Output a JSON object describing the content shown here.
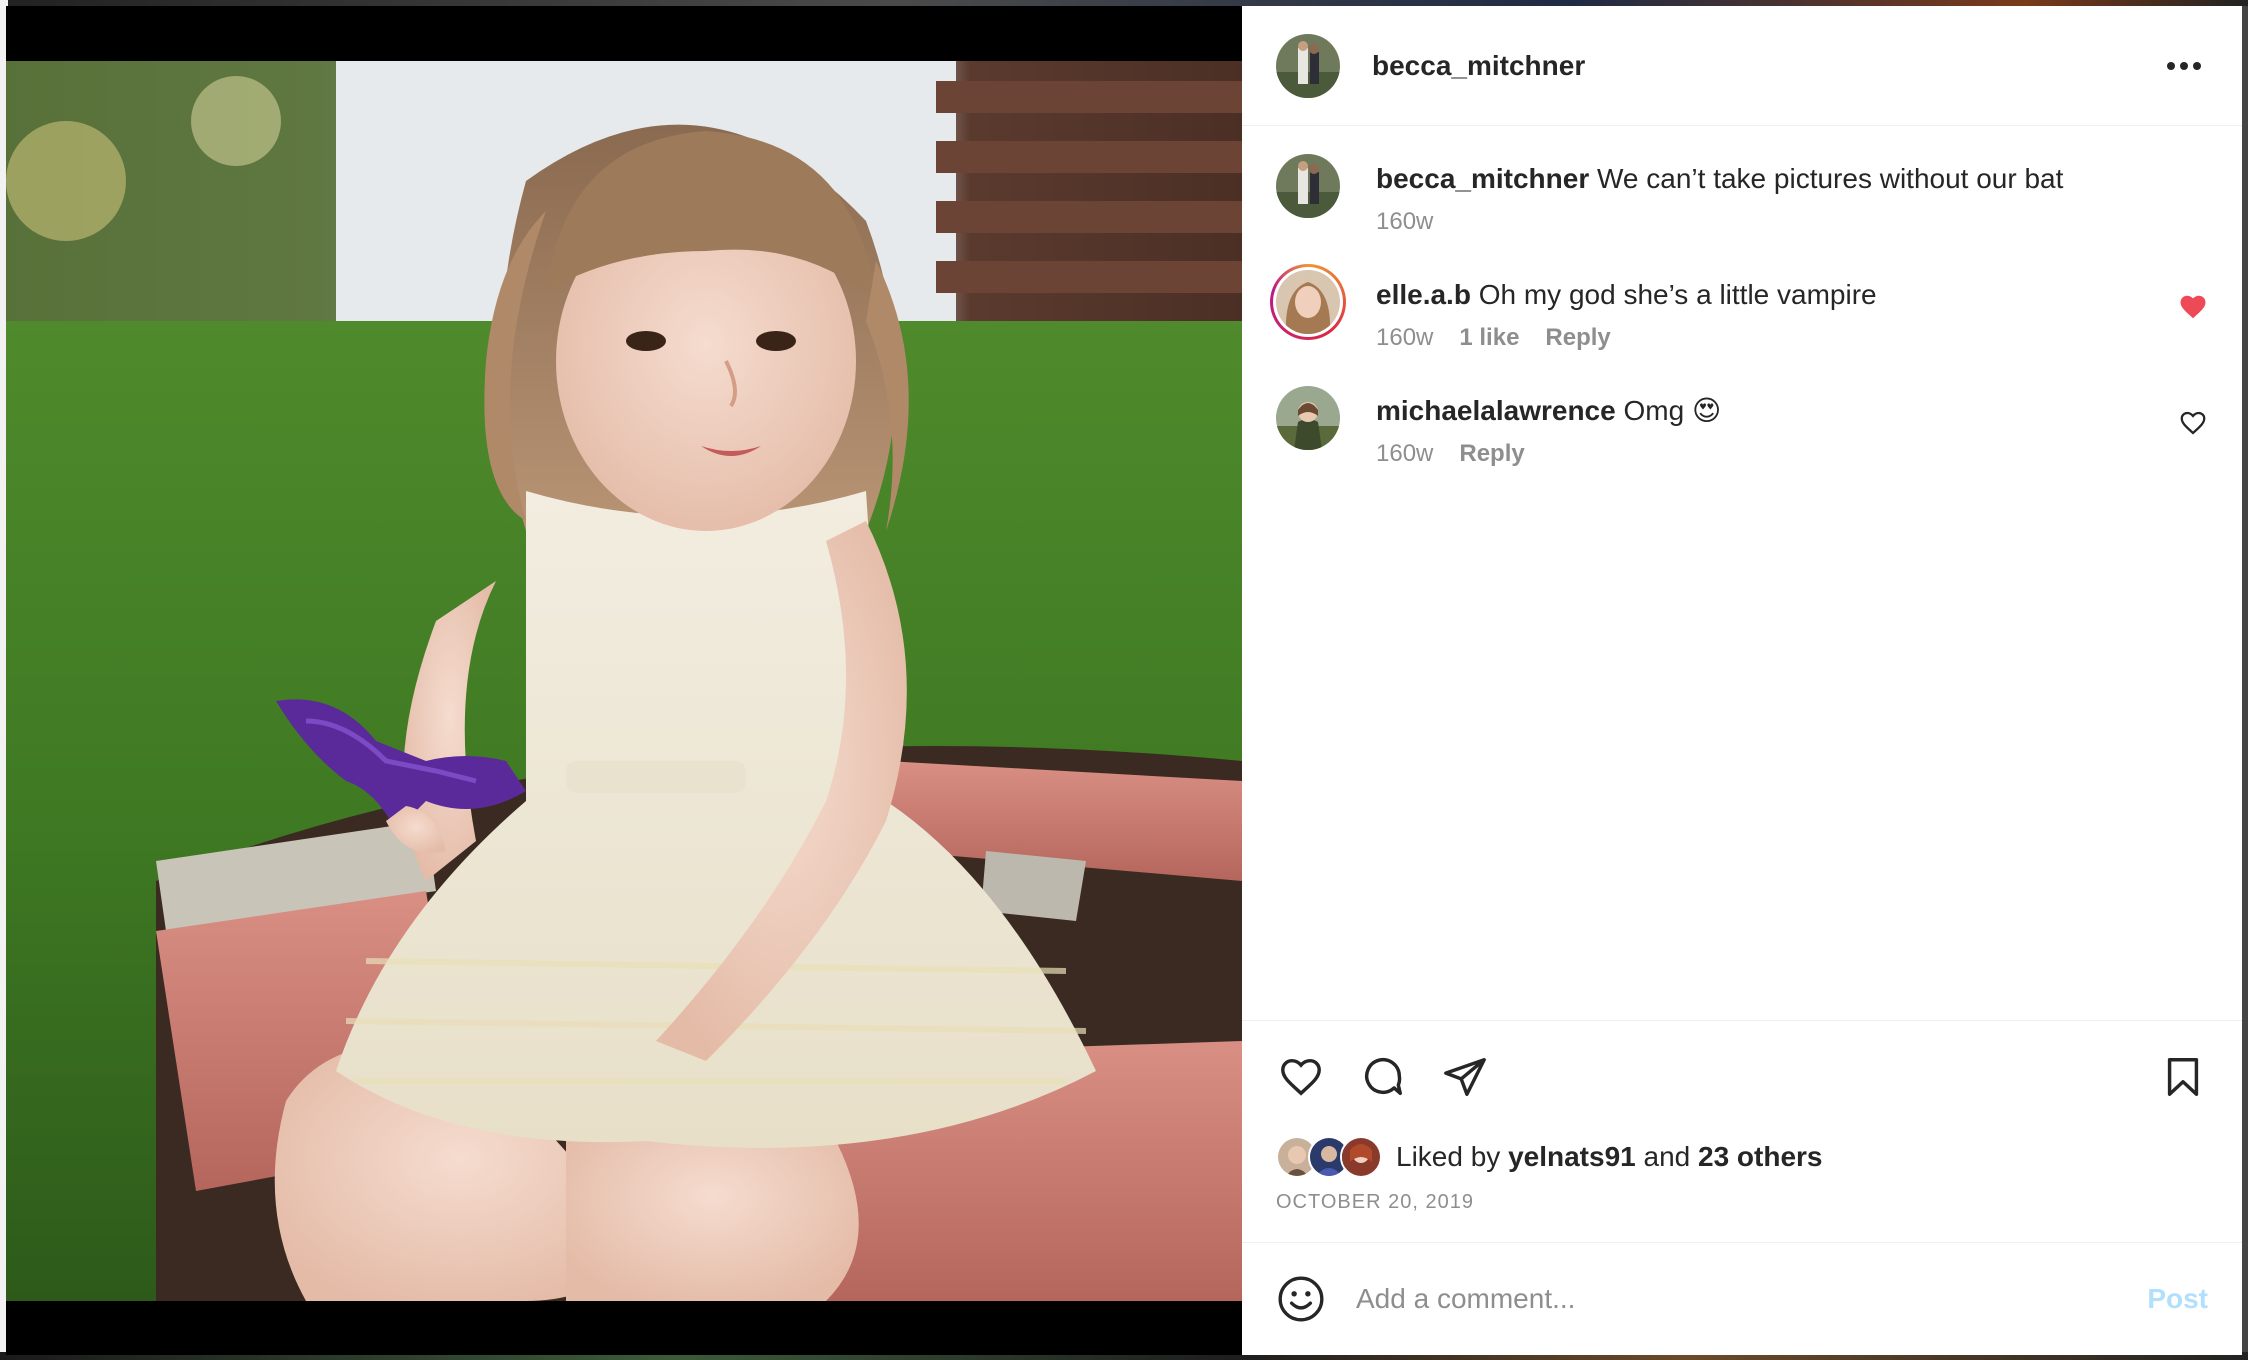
{
  "post": {
    "author": "becca_mitchner",
    "caption": "We can’t take pictures without our bat",
    "caption_age": "160w",
    "date": "OCTOBER 20, 2019",
    "photo_icon": "photo-girl-with-purple-bat"
  },
  "header": {
    "username": "becca_mitchner",
    "more_icon": "more-horizontal-icon"
  },
  "comments": [
    {
      "user": "elle.a.b",
      "text": "Oh my god she’s a little vampire",
      "age": "160w",
      "likes": "1 like",
      "reply": "Reply",
      "liked": true
    },
    {
      "user": "michaelalawrence",
      "text": "Omg 😍",
      "age": "160w",
      "reply": "Reply",
      "liked": false
    }
  ],
  "likes": {
    "prefix": "Liked by",
    "user": "yelnats91",
    "joiner": "and",
    "others": "23 others"
  },
  "add_comment": {
    "placeholder": "Add a comment...",
    "post_label": "Post"
  },
  "colors": {
    "liked_heart": "#ed4956",
    "post_disabled": "#b2dffc",
    "meta_gray": "#8e8e8e"
  }
}
